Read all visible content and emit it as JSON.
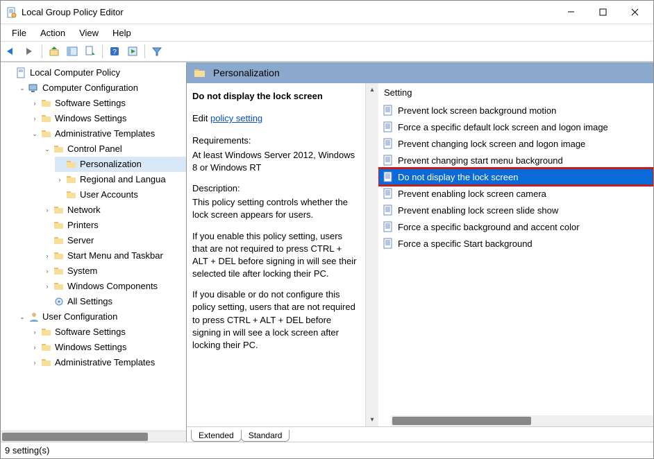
{
  "window": {
    "title": "Local Group Policy Editor"
  },
  "menu": {
    "file": "File",
    "action": "Action",
    "view": "View",
    "help": "Help"
  },
  "tree": {
    "root": "Local Computer Policy",
    "cc": "Computer Configuration",
    "cc_sw": "Software Settings",
    "cc_win": "Windows Settings",
    "cc_at": "Administrative Templates",
    "cp": "Control Panel",
    "pers": "Personalization",
    "regional": "Regional and Langua",
    "ua": "User Accounts",
    "network": "Network",
    "printers": "Printers",
    "server": "Server",
    "start": "Start Menu and Taskbar",
    "system": "System",
    "wincomp": "Windows Components",
    "allsettings": "All Settings",
    "uc": "User Configuration",
    "uc_sw": "Software Settings",
    "uc_win": "Windows Settings",
    "uc_at": "Administrative Templates"
  },
  "header": {
    "category": "Personalization"
  },
  "detail": {
    "title": "Do not display the lock screen",
    "edit_prefix": "Edit ",
    "edit_link": "policy setting",
    "req_heading": "Requirements:",
    "req_body": "At least Windows Server 2012, Windows 8 or Windows RT",
    "desc_heading": "Description:",
    "desc_body1": "This policy setting controls whether the lock screen appears for users.",
    "desc_body2": "If you enable this policy setting, users that are not required to press CTRL + ALT + DEL before signing in will see their selected tile after locking their PC.",
    "desc_body3": "If you disable or do not configure this policy setting, users that are not required to press CTRL + ALT + DEL before signing in will see a lock screen after locking their PC."
  },
  "list": {
    "column": "Setting",
    "items": [
      "Prevent lock screen background motion",
      "Force a specific default lock screen and logon image",
      "Prevent changing lock screen and logon image",
      "Prevent changing start menu background",
      "Do not display the lock screen",
      "Prevent enabling lock screen camera",
      "Prevent enabling lock screen slide show",
      "Force a specific background and accent color",
      "Force a specific Start background"
    ],
    "selected_index": 4
  },
  "tabs": {
    "extended": "Extended",
    "standard": "Standard"
  },
  "status": {
    "text": "9 setting(s)"
  }
}
